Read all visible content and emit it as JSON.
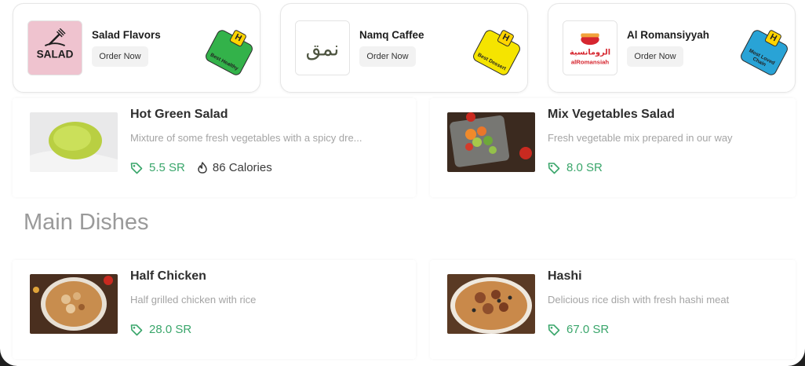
{
  "restaurants": [
    {
      "name": "Salad Flavors",
      "order_label": "Order Now",
      "logo_text": "SALAD",
      "badge_text": "Best Healthy",
      "badge_letter": "H",
      "badge_color": "#33b24a"
    },
    {
      "name": "Namq Caffee",
      "order_label": "Order Now",
      "logo_text": "نمق",
      "badge_text": "Best Dessert",
      "badge_letter": "H",
      "badge_color": "#f5e400"
    },
    {
      "name": "Al Romansiyyah",
      "order_label": "Order Now",
      "logo_text_ar": "الرومانسية",
      "logo_text": "alRomansiah",
      "badge_text": "Most Loved Chain",
      "badge_letter": "H",
      "badge_color": "#29a3d6"
    }
  ],
  "dishes_top": [
    {
      "title": "Hot Green Salad",
      "description": "Mixture of some fresh vegetables with a spicy dre...",
      "price": "5.5 SR",
      "calories": "86 Calories"
    },
    {
      "title": "Mix Vegetables Salad",
      "description": "Fresh vegetable mix prepared in our way",
      "price": "8.0 SR"
    }
  ],
  "section": {
    "title": "Main Dishes"
  },
  "dishes_main": [
    {
      "title": "Half Chicken",
      "description": "Half grilled chicken with rice",
      "price": "28.0 SR"
    },
    {
      "title": "Hashi",
      "description": "Delicious rice dish with fresh hashi meat",
      "price": "67.0 SR"
    }
  ],
  "colors": {
    "price_green": "#3aa66b",
    "accent_red": "#d6262f"
  }
}
